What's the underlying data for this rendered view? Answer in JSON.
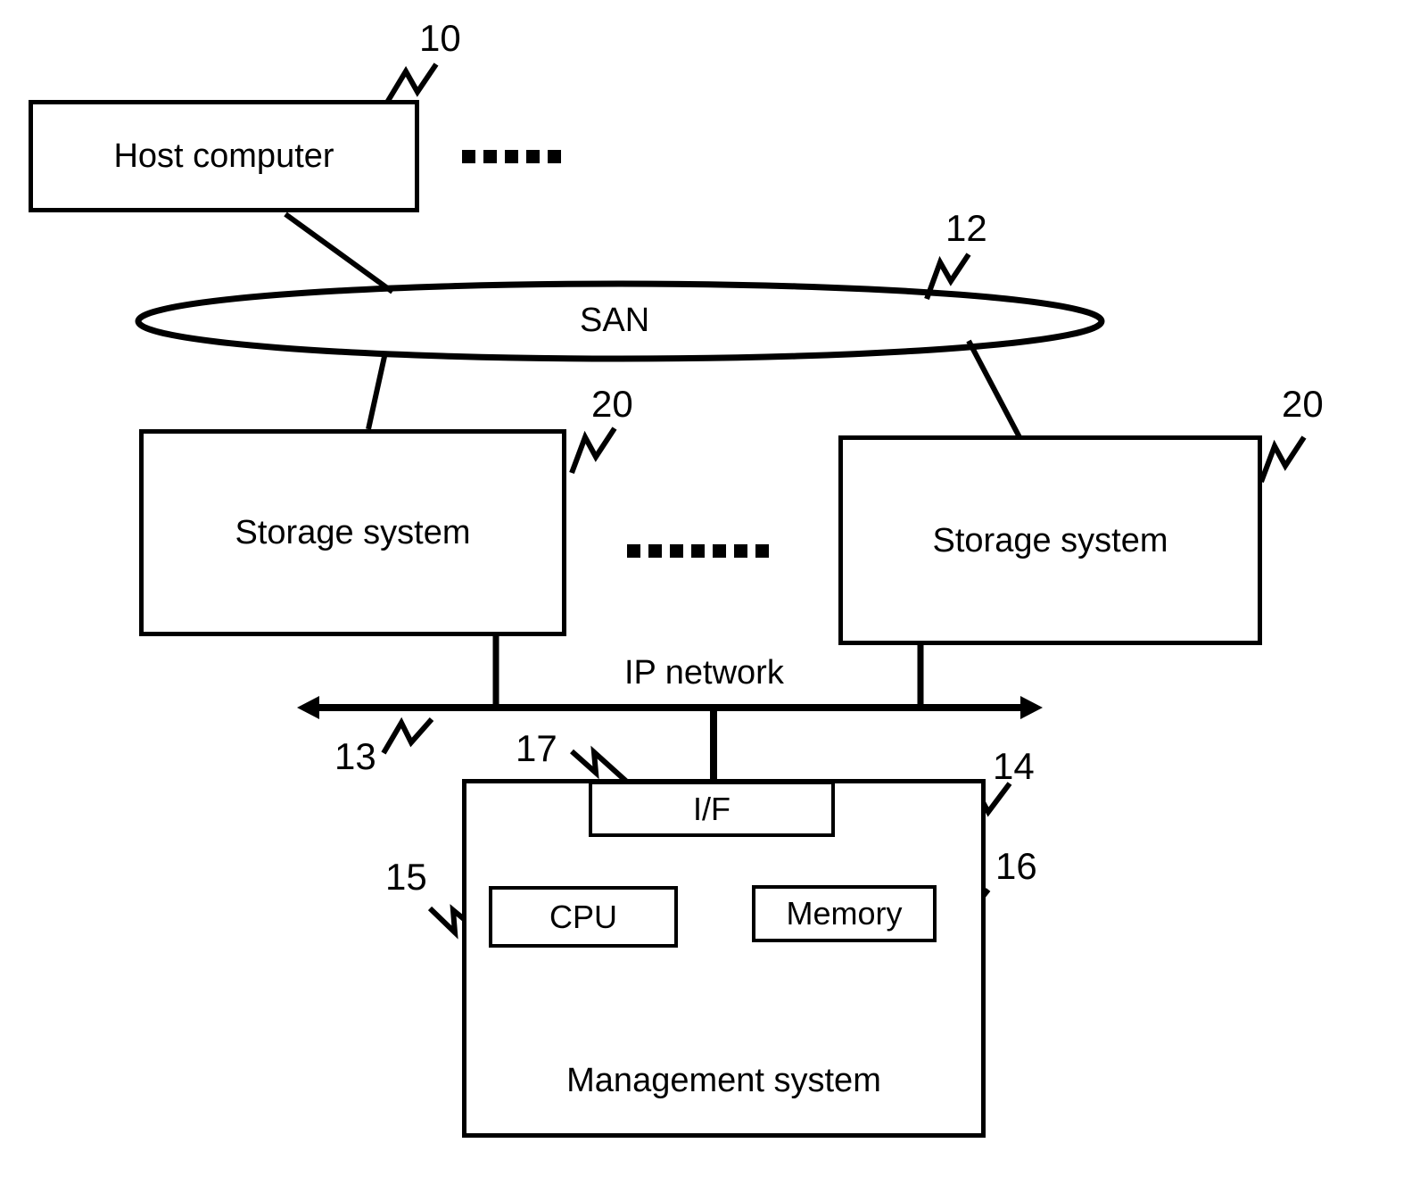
{
  "figure": {
    "type": "patent-block-diagram",
    "nodes": {
      "host_computer": {
        "label": "Host computer",
        "ref": "10"
      },
      "san": {
        "label": "SAN",
        "ref": "12"
      },
      "storage_left": {
        "label": "Storage system",
        "ref": "20"
      },
      "storage_right": {
        "label": "Storage system",
        "ref": "20"
      },
      "ip_network": {
        "label": "IP network",
        "ref": "13"
      },
      "management_system": {
        "label": "Management system",
        "ref": "14"
      },
      "interface": {
        "label": "I/F",
        "ref": "17"
      },
      "cpu": {
        "label": "CPU",
        "ref": "15"
      },
      "memory": {
        "label": "Memory",
        "ref": "16"
      }
    },
    "reference_numerals": [
      {
        "id": "ref-10",
        "text": "10"
      },
      {
        "id": "ref-12",
        "text": "12"
      },
      {
        "id": "ref-20-left",
        "text": "20"
      },
      {
        "id": "ref-20-right",
        "text": "20"
      },
      {
        "id": "ref-13",
        "text": "13"
      },
      {
        "id": "ref-17",
        "text": "17"
      },
      {
        "id": "ref-14",
        "text": "14"
      },
      {
        "id": "ref-15",
        "text": "15"
      },
      {
        "id": "ref-16",
        "text": "16"
      }
    ],
    "ellipsis": {
      "top_count": 5,
      "middle_count": 7
    },
    "colors": {
      "stroke": "#000000",
      "background": "#ffffff"
    }
  }
}
